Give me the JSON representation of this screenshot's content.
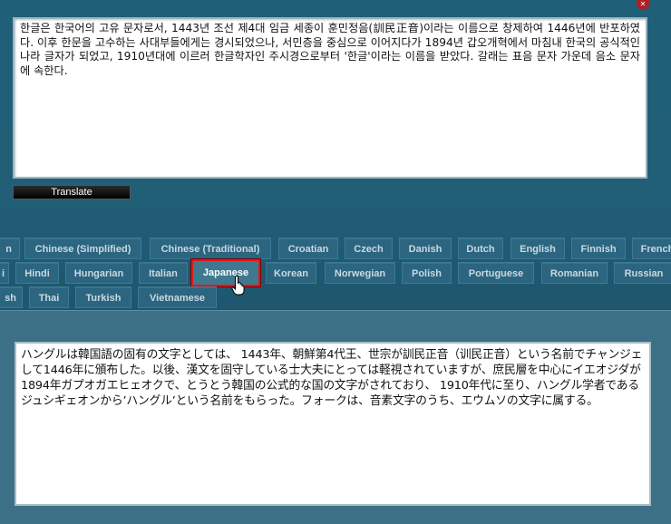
{
  "source_text": "한글은 한국어의 고유 문자로서, 1443년 조선 제4대 임금 세종이 훈민정음(訓民正音)이라는 이름으로 창제하여 1446년에 반포하였다. 이후 한문을 고수하는 사대부들에게는 경시되었으나, 서민층을 중심으로 이어지다가 1894년 갑오개혁에서 마침내 한국의 공식적인 나라 글자가 되었고, 1910년대에 이르러 한글학자인 주시경으로부터 '한글'이라는 이름을 받았다. 갈래는 표음 문자 가운데 음소 문자에 속한다.",
  "translate_button": "Translate",
  "languages": {
    "row1": [
      "...n",
      "Chinese (Simplified)",
      "Chinese (Traditional)",
      "Croatian",
      "Czech",
      "Danish",
      "Dutch",
      "English",
      "Finnish",
      "French"
    ],
    "row2": [
      "...i",
      "Hindi",
      "Hungarian",
      "Italian",
      "Japanese",
      "Korean",
      "Norwegian",
      "Polish",
      "Portuguese",
      "Romanian",
      "Russian"
    ],
    "row3": [
      "...sh",
      "Thai",
      "Turkish",
      "Vietnamese"
    ]
  },
  "selected_language": "Japanese",
  "result_text": "ハングルは韓国語の固有の文字としては、 1443年、朝鮮第4代王、世宗が訓民正音（训民正音）という名前でチャンジェして1446年に頒布した。以後、漢文を固守している士大夫にとっては軽視されていますが、庶民層を中心にイエオジダが1894年ガプオガエヒェオクで、とうとう韓国の公式的な国の文字がされており、 1910年代に至り、ハングル学者であるジュシギェオンから’ハングル’という名前をもらった。フォークは、音素文字のうち、エウムソの文字に属する。",
  "colors": {
    "selected_border": "#e3161b",
    "panel_top": "#1f5f78",
    "panel_bottom": "#3c7087"
  }
}
